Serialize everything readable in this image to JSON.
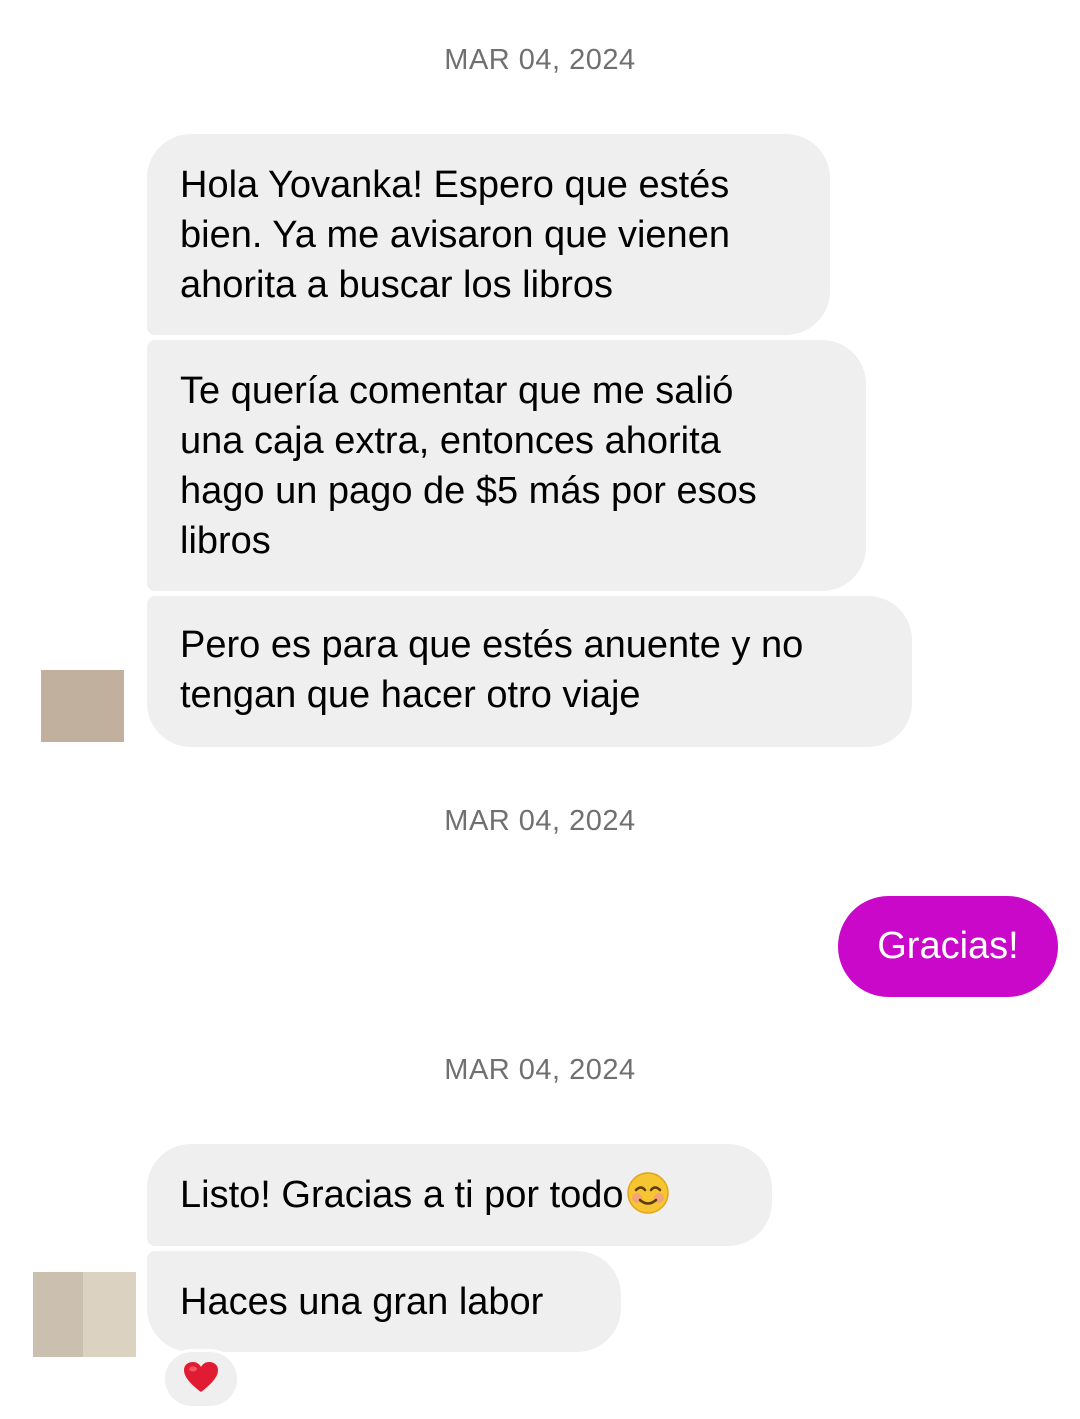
{
  "dates": [
    "MAR 04, 2024",
    "MAR 04, 2024",
    "MAR 04, 2024"
  ],
  "messages": {
    "m1": "Hola Yovanka! Espero que estés\nbien. Ya me avisaron que vienen\nahorita a buscar los libros",
    "m2": "Te quería comentar que me salió\nuna caja extra, entonces ahorita\nhago un pago de $5 más por esos\nlibros",
    "m3": "Pero es para que estés anuente y no\ntengan que hacer otro viaje",
    "sent1": "Gracias!",
    "m4": "Listo! Gracias a ti por todo",
    "m5": "Haces una gran labor"
  },
  "icons": {
    "m4_emoji": "smiling-face-icon",
    "reaction": "heart-icon"
  },
  "colors": {
    "received_bubble": "#efefef",
    "sent_bubble": "#c908c9",
    "date_text": "#707070"
  }
}
